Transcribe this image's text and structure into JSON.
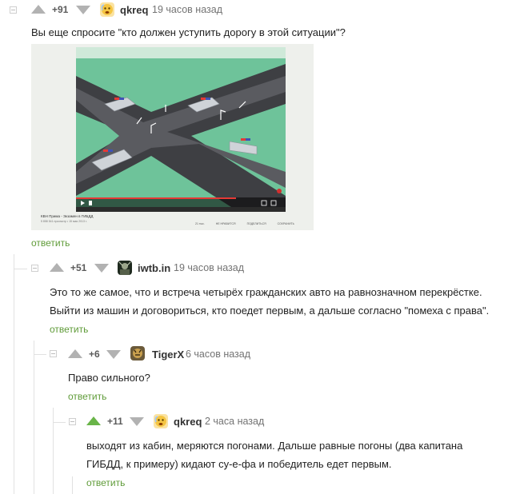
{
  "comments": [
    {
      "rating": "+91",
      "user": "qkreq",
      "time": "19 часов назад",
      "text_lines": [
        "Вы еще спросите \"кто должен уступить дорогу в этой ситуации\"?"
      ],
      "reply": "ответить",
      "video": {
        "title": "КВН Прима - Экзамен в ГИБДД",
        "meta": "5 858 541 просмотр • 15 мая 2013 г.",
        "likes": "21 тыс.",
        "dislike": "НЕ НРАВИТСЯ",
        "share": "ПОДЕЛИТЬСЯ",
        "save": "СОХРАНИТЬ"
      }
    },
    {
      "rating": "+51",
      "user": "iwtb.in",
      "time": "19 часов назад",
      "text_lines": [
        "Это то же самое, что и встреча четырёх гражданских авто на равнозначном перекрёстке.",
        "Выйти из машин и договориться, кто поедет первым, а дальше согласно \"помеха с права\"."
      ],
      "reply": "ответить"
    },
    {
      "rating": "+6",
      "user": "TigerX",
      "time": "6 часов назад",
      "text_lines": [
        "Право сильного?"
      ],
      "reply": "ответить"
    },
    {
      "rating": "+11",
      "user": "qkreq",
      "time": "2 часа назад",
      "text_lines": [
        "выходят из кабин, меряются погонами. Дальше равные погоны (два капитана",
        "ГИБДД, к примеру) кидают су-е-фа и победитель едет первым."
      ],
      "reply": "ответить"
    }
  ],
  "colors": {
    "upvote_active": "#69b448",
    "reply_link": "#5f9b38",
    "muted": "#b2b2b2"
  }
}
